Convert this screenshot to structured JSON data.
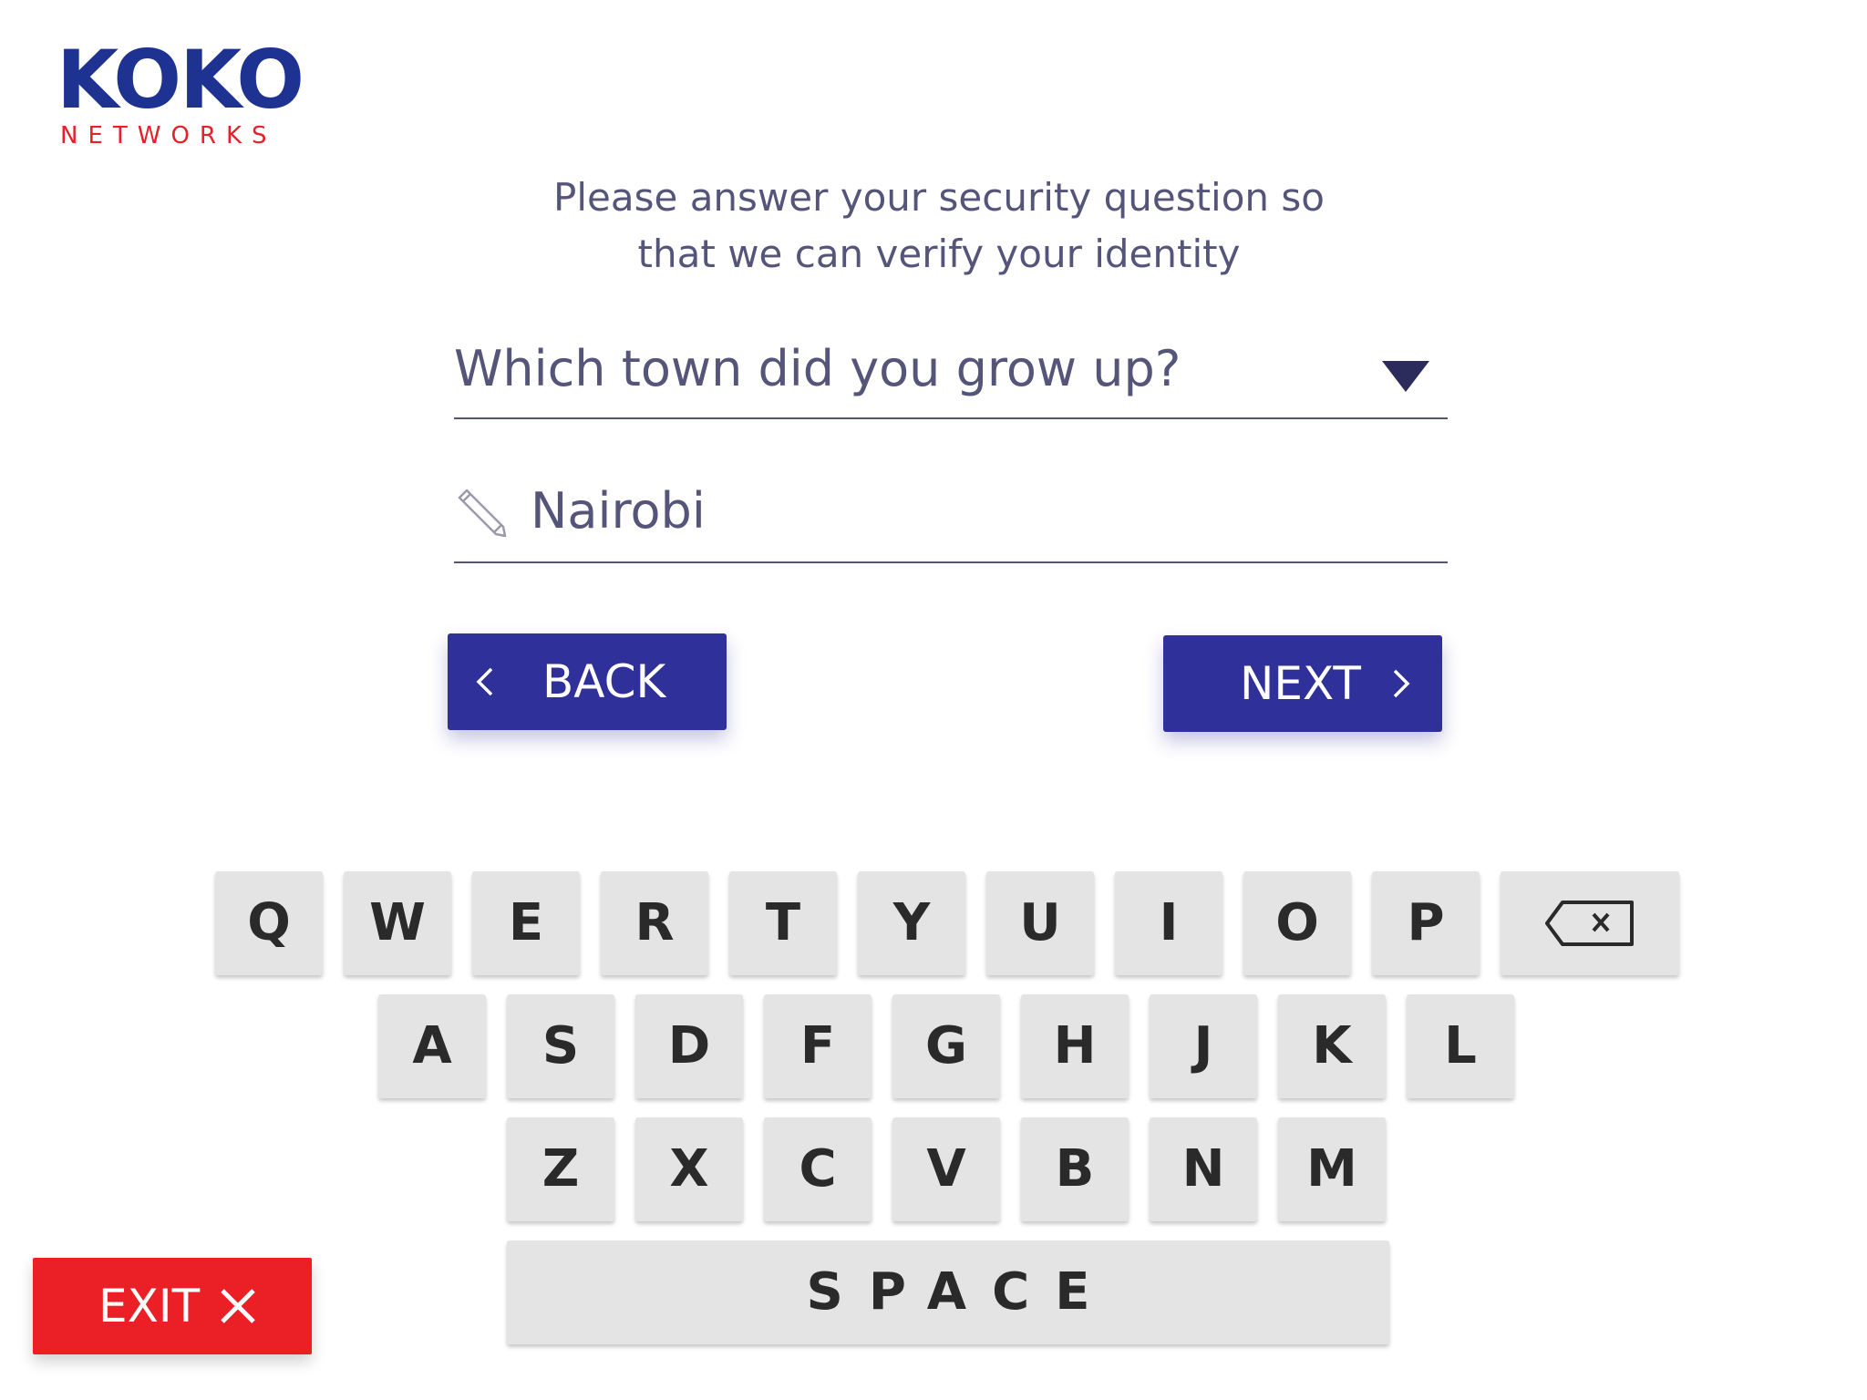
{
  "brand": {
    "name": "KOKO",
    "tagline": "NETWORKS",
    "primary_color": "#1e3391",
    "accent_color": "#e8202a"
  },
  "prompt": {
    "line1": "Please answer your security question so",
    "line2": "that we can verify your identity"
  },
  "security_question": {
    "selected": "Which town did you grow up?",
    "icon": "chevron-down-icon"
  },
  "answer": {
    "value": "Nairobi",
    "icon": "pencil-icon"
  },
  "buttons": {
    "back": "BACK",
    "next": "NEXT",
    "exit": "EXIT",
    "color": "#30309a",
    "exit_color": "#eb2027"
  },
  "keyboard": {
    "row1": [
      "Q",
      "W",
      "E",
      "R",
      "T",
      "Y",
      "U",
      "I",
      "O",
      "P"
    ],
    "row2": [
      "A",
      "S",
      "D",
      "F",
      "G",
      "H",
      "J",
      "K",
      "L"
    ],
    "row3": [
      "Z",
      "X",
      "C",
      "V",
      "B",
      "N",
      "M"
    ],
    "backspace_icon": "backspace-icon",
    "space": "SPACE"
  }
}
